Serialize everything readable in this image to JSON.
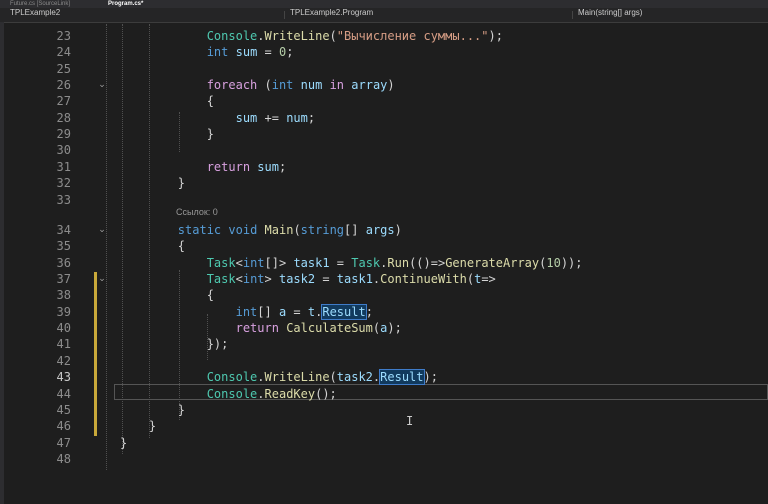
{
  "tabs": [
    {
      "label": "Future.cs [SourceLink]",
      "active": false
    },
    {
      "label": "Program.cs*",
      "active": true
    }
  ],
  "navbar": {
    "project": "TPLExample2",
    "class": "TPLExample2.Program",
    "member": "Main(string[] args)"
  },
  "code_lens": {
    "main_refs": "Ссылок: 0"
  },
  "lines": [
    {
      "n": "23",
      "tokens": [
        [
          "pl",
          "            "
        ],
        [
          "ty",
          "Console"
        ],
        [
          "pl",
          "."
        ],
        [
          "fn",
          "WriteLine"
        ],
        [
          "pl",
          "("
        ],
        [
          "st",
          "\"Вычисление суммы...\""
        ],
        [
          "pl",
          ");"
        ]
      ]
    },
    {
      "n": "24",
      "tokens": [
        [
          "pl",
          "            "
        ],
        [
          "kw",
          "int"
        ],
        [
          "pl",
          " "
        ],
        [
          "id",
          "sum"
        ],
        [
          "pl",
          " = "
        ],
        [
          "nu",
          "0"
        ],
        [
          "pl",
          ";"
        ]
      ]
    },
    {
      "n": "25",
      "tokens": []
    },
    {
      "n": "26",
      "fold": true,
      "tokens": [
        [
          "pl",
          "            "
        ],
        [
          "kc",
          "foreach"
        ],
        [
          "pl",
          " ("
        ],
        [
          "kw",
          "int"
        ],
        [
          "pl",
          " "
        ],
        [
          "id",
          "num"
        ],
        [
          "pl",
          " "
        ],
        [
          "kc",
          "in"
        ],
        [
          "pl",
          " "
        ],
        [
          "id",
          "array"
        ],
        [
          "pl",
          ")"
        ]
      ]
    },
    {
      "n": "27",
      "tokens": [
        [
          "pl",
          "            {"
        ]
      ]
    },
    {
      "n": "28",
      "tokens": [
        [
          "pl",
          "                "
        ],
        [
          "id",
          "sum"
        ],
        [
          "pl",
          " += "
        ],
        [
          "id",
          "num"
        ],
        [
          "pl",
          ";"
        ]
      ]
    },
    {
      "n": "29",
      "tokens": [
        [
          "pl",
          "            }"
        ]
      ]
    },
    {
      "n": "30",
      "tokens": []
    },
    {
      "n": "31",
      "tokens": [
        [
          "pl",
          "            "
        ],
        [
          "kc",
          "return"
        ],
        [
          "pl",
          " "
        ],
        [
          "id",
          "sum"
        ],
        [
          "pl",
          ";"
        ]
      ]
    },
    {
      "n": "32",
      "tokens": [
        [
          "pl",
          "        }"
        ]
      ]
    },
    {
      "n": "33",
      "tokens": []
    },
    {
      "n": "34",
      "fold": true,
      "tokens": [
        [
          "pl",
          "        "
        ],
        [
          "kw",
          "static"
        ],
        [
          "pl",
          " "
        ],
        [
          "kw",
          "void"
        ],
        [
          "pl",
          " "
        ],
        [
          "fn",
          "Main"
        ],
        [
          "pl",
          "("
        ],
        [
          "kw",
          "string"
        ],
        [
          "pl",
          "[] "
        ],
        [
          "id",
          "args"
        ],
        [
          "pl",
          ")"
        ]
      ]
    },
    {
      "n": "35",
      "tokens": [
        [
          "pl",
          "        {"
        ]
      ]
    },
    {
      "n": "36",
      "tokens": [
        [
          "pl",
          "            "
        ],
        [
          "ty",
          "Task"
        ],
        [
          "pl",
          "<"
        ],
        [
          "kw",
          "int"
        ],
        [
          "pl",
          "[]> "
        ],
        [
          "id",
          "task1"
        ],
        [
          "pl",
          " = "
        ],
        [
          "ty",
          "Task"
        ],
        [
          "pl",
          "."
        ],
        [
          "fn",
          "Run"
        ],
        [
          "pl",
          "(()=>"
        ],
        [
          "fn",
          "GenerateArray"
        ],
        [
          "pl",
          "("
        ],
        [
          "nu",
          "10"
        ],
        [
          "pl",
          "));"
        ]
      ]
    },
    {
      "n": "37",
      "fold": true,
      "tokens": [
        [
          "pl",
          "            "
        ],
        [
          "ty",
          "Task"
        ],
        [
          "pl",
          "<"
        ],
        [
          "kw",
          "int"
        ],
        [
          "pl",
          "> "
        ],
        [
          "id",
          "task2"
        ],
        [
          "pl",
          " = "
        ],
        [
          "id",
          "task1"
        ],
        [
          "pl",
          "."
        ],
        [
          "fn",
          "ContinueWith"
        ],
        [
          "pl",
          "("
        ],
        [
          "id",
          "t"
        ],
        [
          "pl",
          "=>"
        ]
      ]
    },
    {
      "n": "38",
      "tokens": [
        [
          "pl",
          "            {"
        ]
      ]
    },
    {
      "n": "39",
      "tokens": [
        [
          "pl",
          "                "
        ],
        [
          "kw",
          "int"
        ],
        [
          "pl",
          "[] "
        ],
        [
          "id",
          "a"
        ],
        [
          "pl",
          " = "
        ],
        [
          "id",
          "t"
        ],
        [
          "pl",
          "."
        ],
        [
          "id hl",
          "Result"
        ],
        [
          "pl",
          ";"
        ]
      ]
    },
    {
      "n": "40",
      "tokens": [
        [
          "pl",
          "                "
        ],
        [
          "kc",
          "return"
        ],
        [
          "pl",
          " "
        ],
        [
          "fn",
          "CalculateSum"
        ],
        [
          "pl",
          "("
        ],
        [
          "id",
          "a"
        ],
        [
          "pl",
          ");"
        ]
      ]
    },
    {
      "n": "41",
      "tokens": [
        [
          "pl",
          "            });"
        ]
      ]
    },
    {
      "n": "42",
      "tokens": []
    },
    {
      "n": "43",
      "cur": true,
      "tokens": [
        [
          "pl",
          "            "
        ],
        [
          "ty",
          "Console"
        ],
        [
          "pl",
          "."
        ],
        [
          "fn",
          "WriteLine"
        ],
        [
          "pl",
          "("
        ],
        [
          "id",
          "task2"
        ],
        [
          "pl",
          "."
        ],
        [
          "id hl",
          "Result"
        ],
        [
          "pl",
          ");"
        ]
      ]
    },
    {
      "n": "44",
      "tokens": [
        [
          "pl",
          "            "
        ],
        [
          "ty",
          "Console"
        ],
        [
          "pl",
          "."
        ],
        [
          "fn",
          "ReadKey"
        ],
        [
          "pl",
          "();"
        ]
      ]
    },
    {
      "n": "45",
      "tokens": [
        [
          "pl",
          "        }"
        ]
      ]
    },
    {
      "n": "46",
      "tokens": [
        [
          "pl",
          "    }"
        ]
      ]
    },
    {
      "n": "47",
      "tokens": [
        [
          "pl",
          "}"
        ]
      ]
    },
    {
      "n": "48",
      "tokens": []
    }
  ],
  "colors": {
    "background": "#1e1e1e",
    "keyword": "#569cd6",
    "control": "#d8a0df",
    "type": "#4ec9b0",
    "method": "#dcdcaa",
    "string": "#d69d85",
    "number": "#b5cea8",
    "identifier": "#9cdcfe",
    "change_margin": "#c9a93a"
  }
}
